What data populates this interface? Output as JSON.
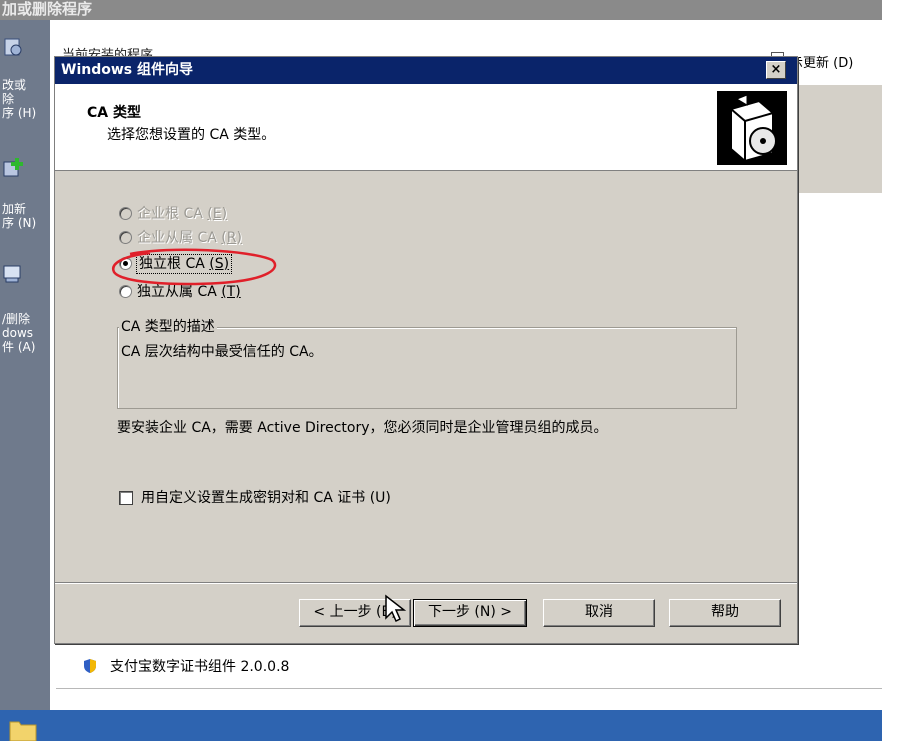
{
  "background_window": {
    "title": "加或删除程序",
    "top_line": "当前安装的程序",
    "show_updates_label": "示更新 (D)",
    "sidebar": [
      {
        "label": "改或\n除\n序 (H)"
      },
      {
        "label": "加新\n序 (N)"
      },
      {
        "label": "/删除\ndows\n件 (A)"
      }
    ],
    "installed_program": "支付宝数字证书组件 2.0.0.8"
  },
  "dialog": {
    "title": "Windows 组件向导",
    "close_label": "×",
    "header_title": "CA 类型",
    "header_subtitle": "选择您想设置的 CA 类型。",
    "options": [
      {
        "label_main": "企业根 CA",
        "label_key": "(E)",
        "enabled": false,
        "selected": false
      },
      {
        "label_main": "企业从属 CA",
        "label_key": "(R)",
        "enabled": false,
        "selected": false
      },
      {
        "label_main": "独立根 CA",
        "label_key": "(S)",
        "enabled": true,
        "selected": true
      },
      {
        "label_main": "独立从属 CA",
        "label_key": "(T)",
        "enabled": true,
        "selected": false
      }
    ],
    "description_group_title": "CA 类型的描述",
    "description_text": "CA 层次结构中最受信任的 CA。",
    "note": "要安装企业 CA，需要 Active Directory，您必须同时是企业管理员组的成员。",
    "checkbox_label": "用自定义设置生成密钥对和 CA 证书 (U)",
    "checkbox_checked": false,
    "buttons": {
      "back": "< 上一步 (B)",
      "next": "下一步 (N) >",
      "cancel": "取消",
      "help": "帮助"
    }
  },
  "colors": {
    "titlebar": "#0a246a",
    "dialog_face": "#d4d0c8",
    "annotation": "#e0202a",
    "taskbar": "#2e64b0"
  }
}
